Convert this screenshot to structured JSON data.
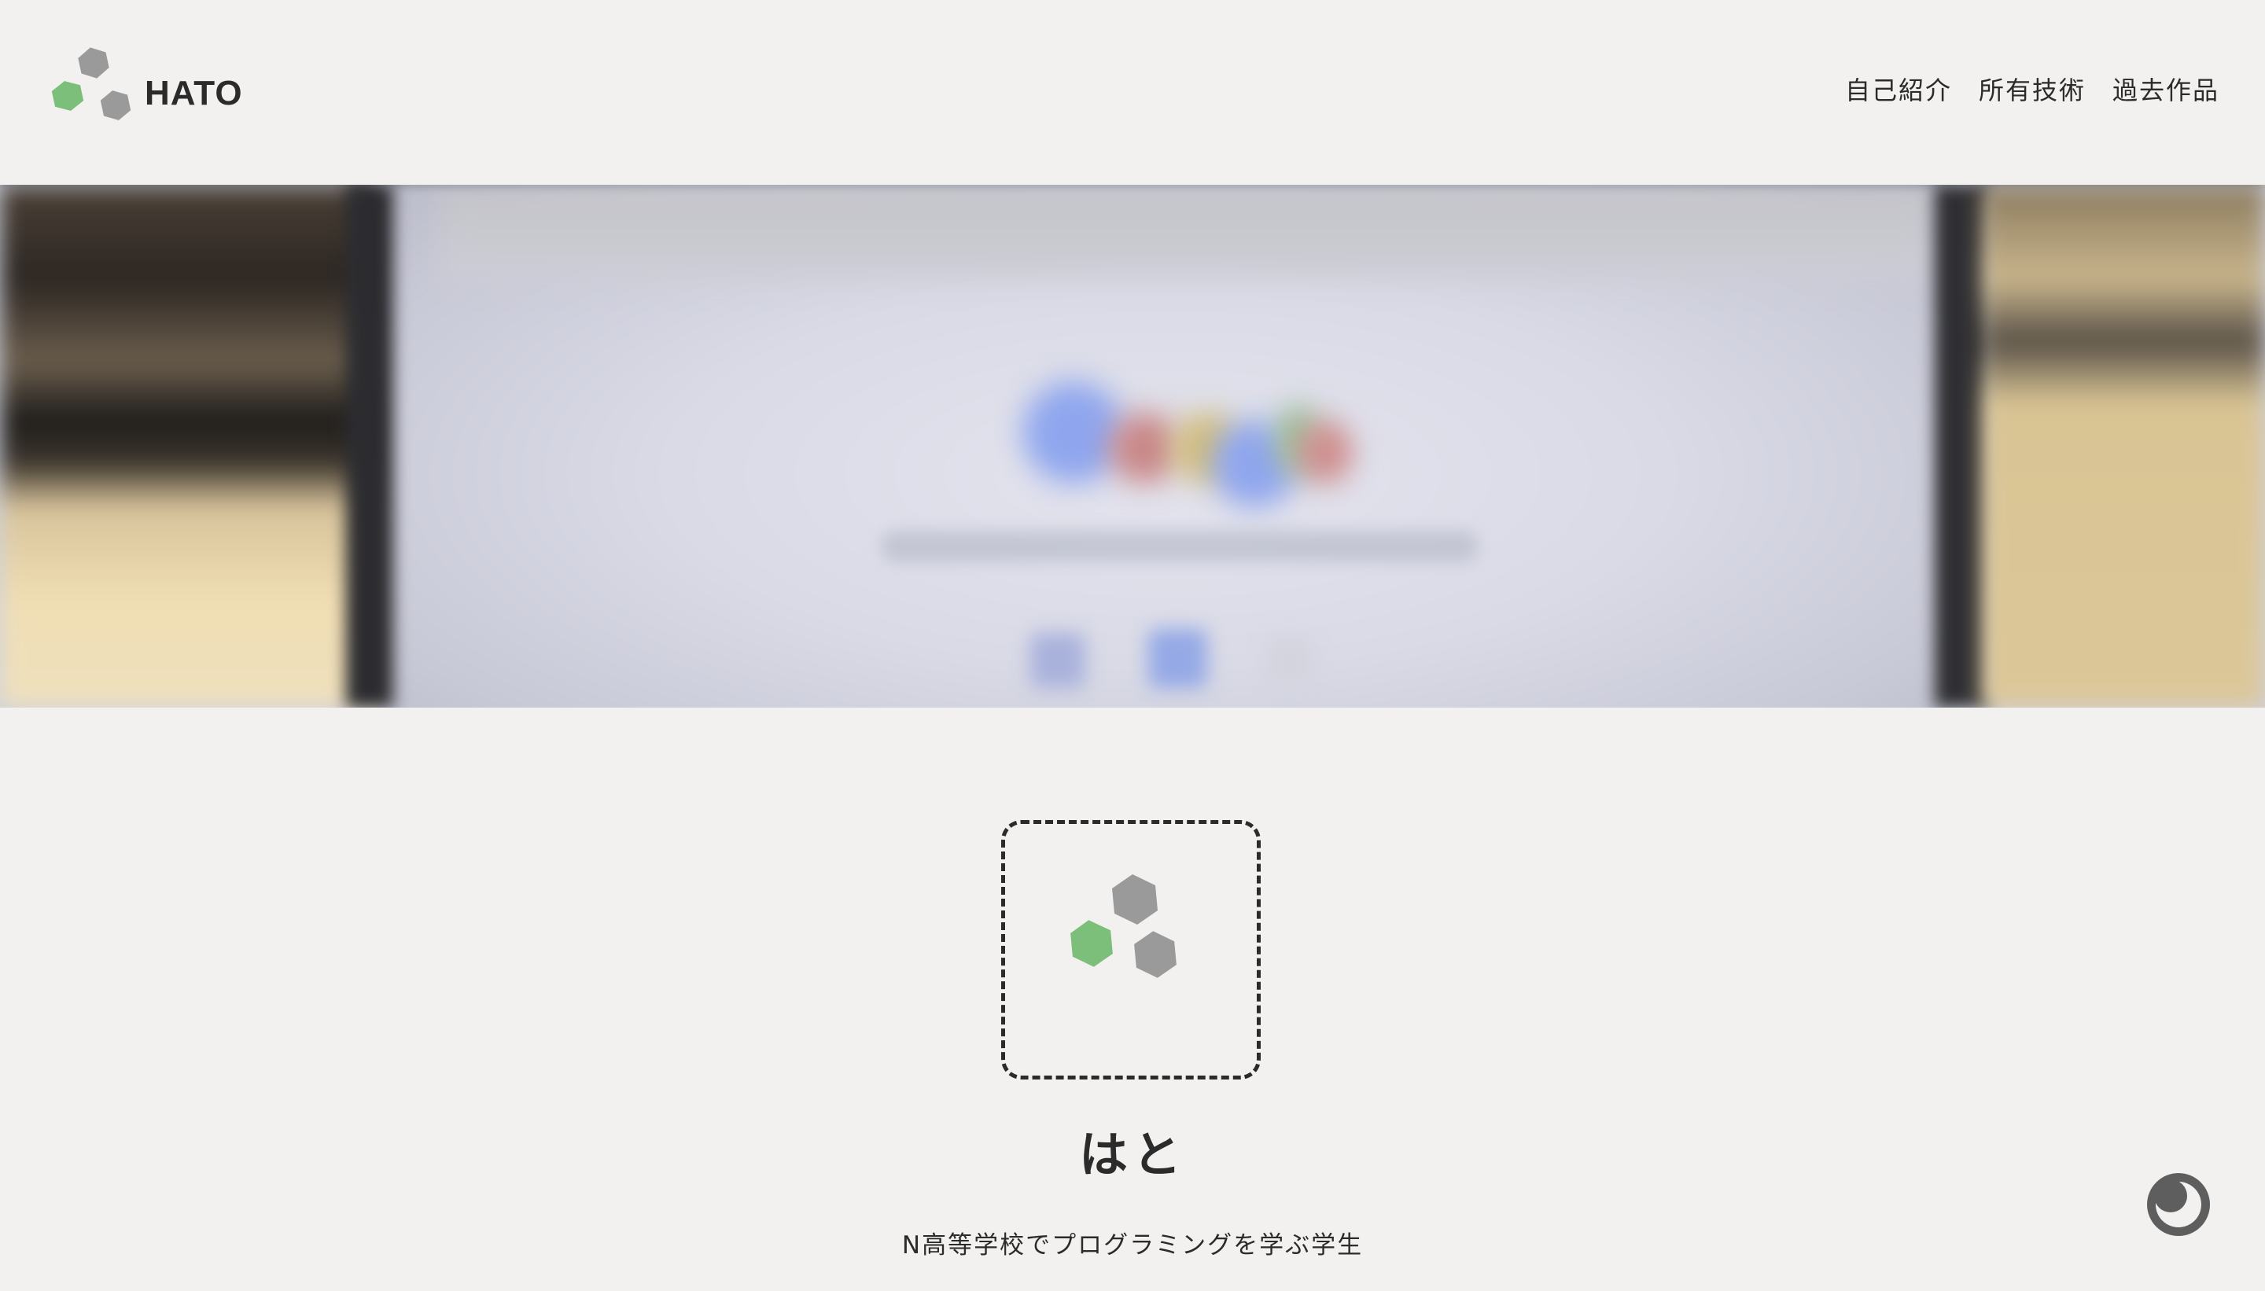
{
  "header": {
    "brand": {
      "logo_icon": "hexagon-cluster-logo-icon",
      "name": "HATO"
    },
    "nav": [
      {
        "label": "自己紹介"
      },
      {
        "label": "所有技術"
      },
      {
        "label": "過去作品"
      }
    ]
  },
  "hero": {
    "image": "blurred-laptop-screen-photo"
  },
  "profile": {
    "avatar_icon": "hexagon-cluster-logo-icon",
    "name": "はと",
    "tagline": "N高等学校でプログラミングを学ぶ学生"
  },
  "theme_toggle": {
    "icon": "crescent-moon-icon"
  },
  "colors": {
    "background": "#f2f1ef",
    "text": "#2b2b2b",
    "hex_green": "#7bbf7a",
    "hex_gray": "#9a9a9a"
  }
}
